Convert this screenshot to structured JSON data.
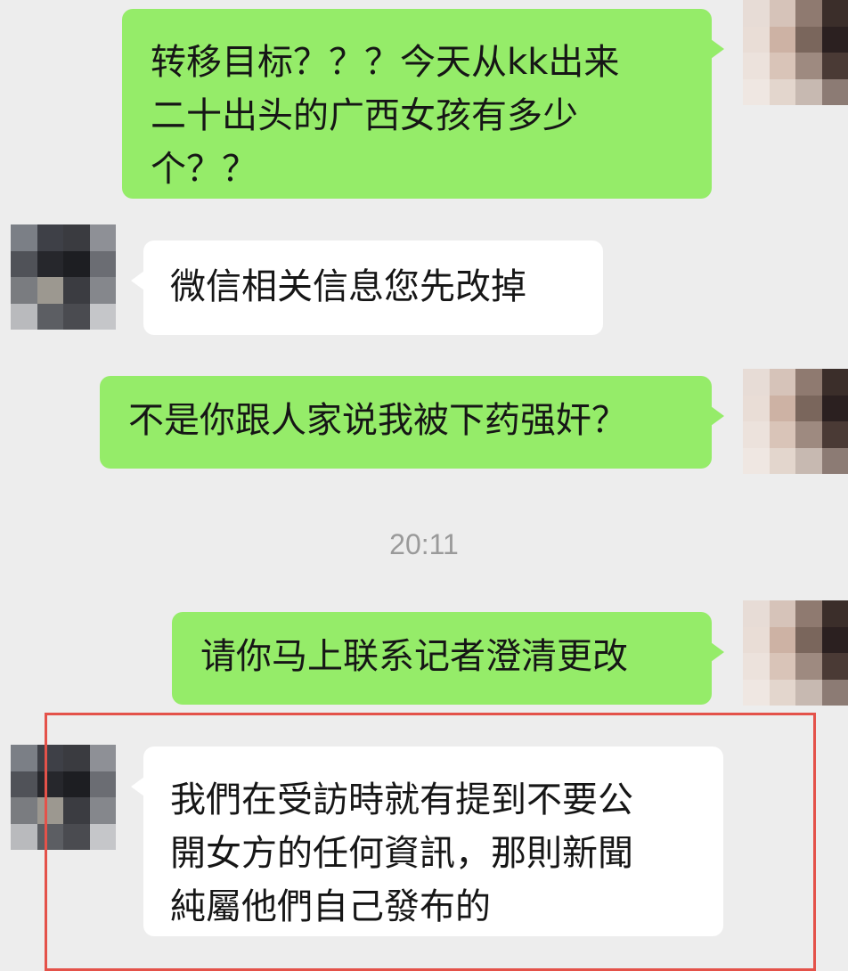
{
  "messages": [
    {
      "from": "me",
      "text": "转移目标？？？今天从kk出来\n二十出头的广西女孩有多少\n个？？"
    },
    {
      "from": "other",
      "text": "微信相关信息您先改掉"
    },
    {
      "from": "me",
      "text": "不是你跟人家说我被下药强奸？"
    },
    {
      "from": "other",
      "text": "请你马上联系记者澄清更改"
    },
    {
      "from": "other",
      "text": "我們在受訪時就有提到不要公\n開女方的任何資訊，那則新聞\n純屬他們自己發布的"
    }
  ],
  "timestamp": "20:11",
  "colors": {
    "background": "#ededed",
    "sent_bubble": "#95ec69",
    "received_bubble": "#ffffff",
    "highlight_border": "#e4524a",
    "timestamp_text": "#9a9a9a"
  },
  "avatars": {
    "me": "pixelated-avatar-light",
    "other": "pixelated-avatar-dark"
  }
}
